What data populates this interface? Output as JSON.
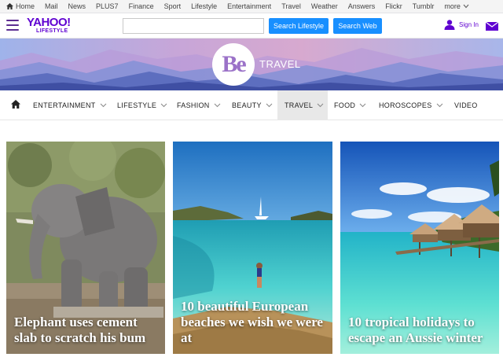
{
  "topbar": {
    "items": [
      "Home",
      "Mail",
      "News",
      "PLUS7",
      "Finance",
      "Sport",
      "Lifestyle",
      "Entertainment",
      "Travel",
      "Weather",
      "Answers",
      "Flickr",
      "Tumblr",
      "more"
    ]
  },
  "header": {
    "logo_brand": "YAHOO!",
    "logo_sub": "LIFESTYLE",
    "search_value": "",
    "search_lifestyle_label": "Search Lifestyle",
    "search_web_label": "Search Web",
    "signin_label": "Sign In",
    "accent_color": "#5f01d1",
    "button_color": "#188fff"
  },
  "banner": {
    "logo_text": "Be",
    "section_title": "TRAVEL"
  },
  "catnav": {
    "items": [
      {
        "label": "ENTERTAINMENT",
        "has_dropdown": true
      },
      {
        "label": "LIFESTYLE",
        "has_dropdown": true
      },
      {
        "label": "FASHION",
        "has_dropdown": true
      },
      {
        "label": "BEAUTY",
        "has_dropdown": true
      },
      {
        "label": "TRAVEL",
        "has_dropdown": true,
        "active": true
      },
      {
        "label": "FOOD",
        "has_dropdown": true
      },
      {
        "label": "HOROSCOPES",
        "has_dropdown": true
      },
      {
        "label": "VIDEO",
        "has_dropdown": false
      }
    ]
  },
  "articles": [
    {
      "headline": "Elephant uses cement slab to scratch his bum",
      "image": "elephant-photo"
    },
    {
      "headline": "10 beautiful European beaches we wish we were at",
      "image": "beach-cove-photo"
    },
    {
      "headline": "10 tropical holidays to escape an Aussie winter",
      "image": "overwater-bungalows-photo"
    }
  ]
}
